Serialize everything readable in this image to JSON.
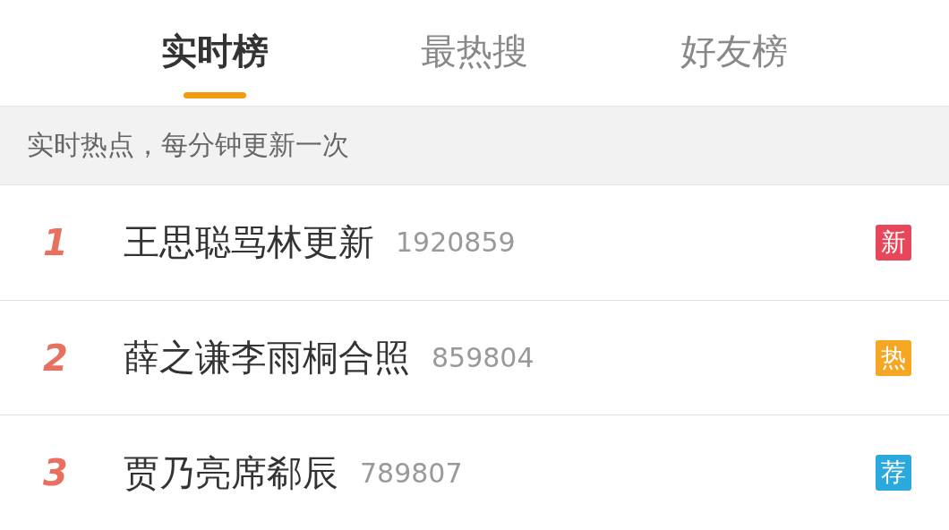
{
  "tabs": [
    {
      "label": "实时榜",
      "selected": true
    },
    {
      "label": "最热搜",
      "selected": false
    },
    {
      "label": "好友榜",
      "selected": false
    }
  ],
  "notice": "实时热点，每分钟更新一次",
  "items": [
    {
      "rank": "1",
      "title": "王思聪骂林更新",
      "count": "1920859",
      "badge": "新",
      "color": "#e8465a"
    },
    {
      "rank": "2",
      "title": "薛之谦李雨桐合照",
      "count": "859804",
      "badge": "热",
      "color": "#f5a623"
    },
    {
      "rank": "3",
      "title": "贾乃亮席郗辰",
      "count": "789807",
      "badge": "荐",
      "color": "#2aa9de"
    }
  ]
}
